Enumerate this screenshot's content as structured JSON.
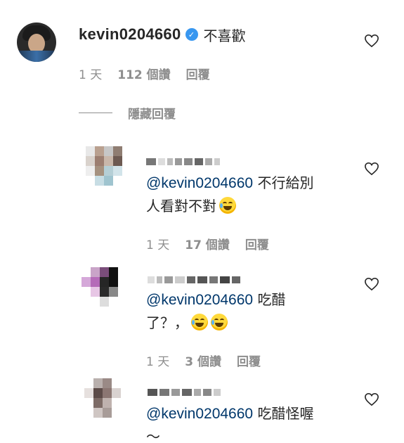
{
  "main_comment": {
    "username": "kevin0204660",
    "text": "不喜歡",
    "time": "1 天",
    "likes": "112 個讚",
    "reply": "回覆"
  },
  "hide_replies": "隱藏回覆",
  "replies": [
    {
      "mention": "@kevin0204660",
      "text_line1": " 不行給別",
      "text_line2": "人看對不對",
      "time": "1 天",
      "likes": "17 個讚",
      "reply": "回覆"
    },
    {
      "mention": "@kevin0204660",
      "text_line1": " 吃醋",
      "text_line2": "了？，",
      "time": "1 天",
      "likes": "3 個讚",
      "reply": "回覆"
    },
    {
      "mention": "@kevin0204660",
      "text_line1": " 吃醋怪喔",
      "text_line2": "～"
    }
  ],
  "icons": {
    "verified": "verified-badge-icon",
    "like": "heart-outline-icon",
    "emoji": "face-with-tears-of-joy-icon"
  },
  "colors": {
    "text": "#262626",
    "meta": "#8e8e8e",
    "mention": "#00376b",
    "verified": "#3897f0"
  }
}
